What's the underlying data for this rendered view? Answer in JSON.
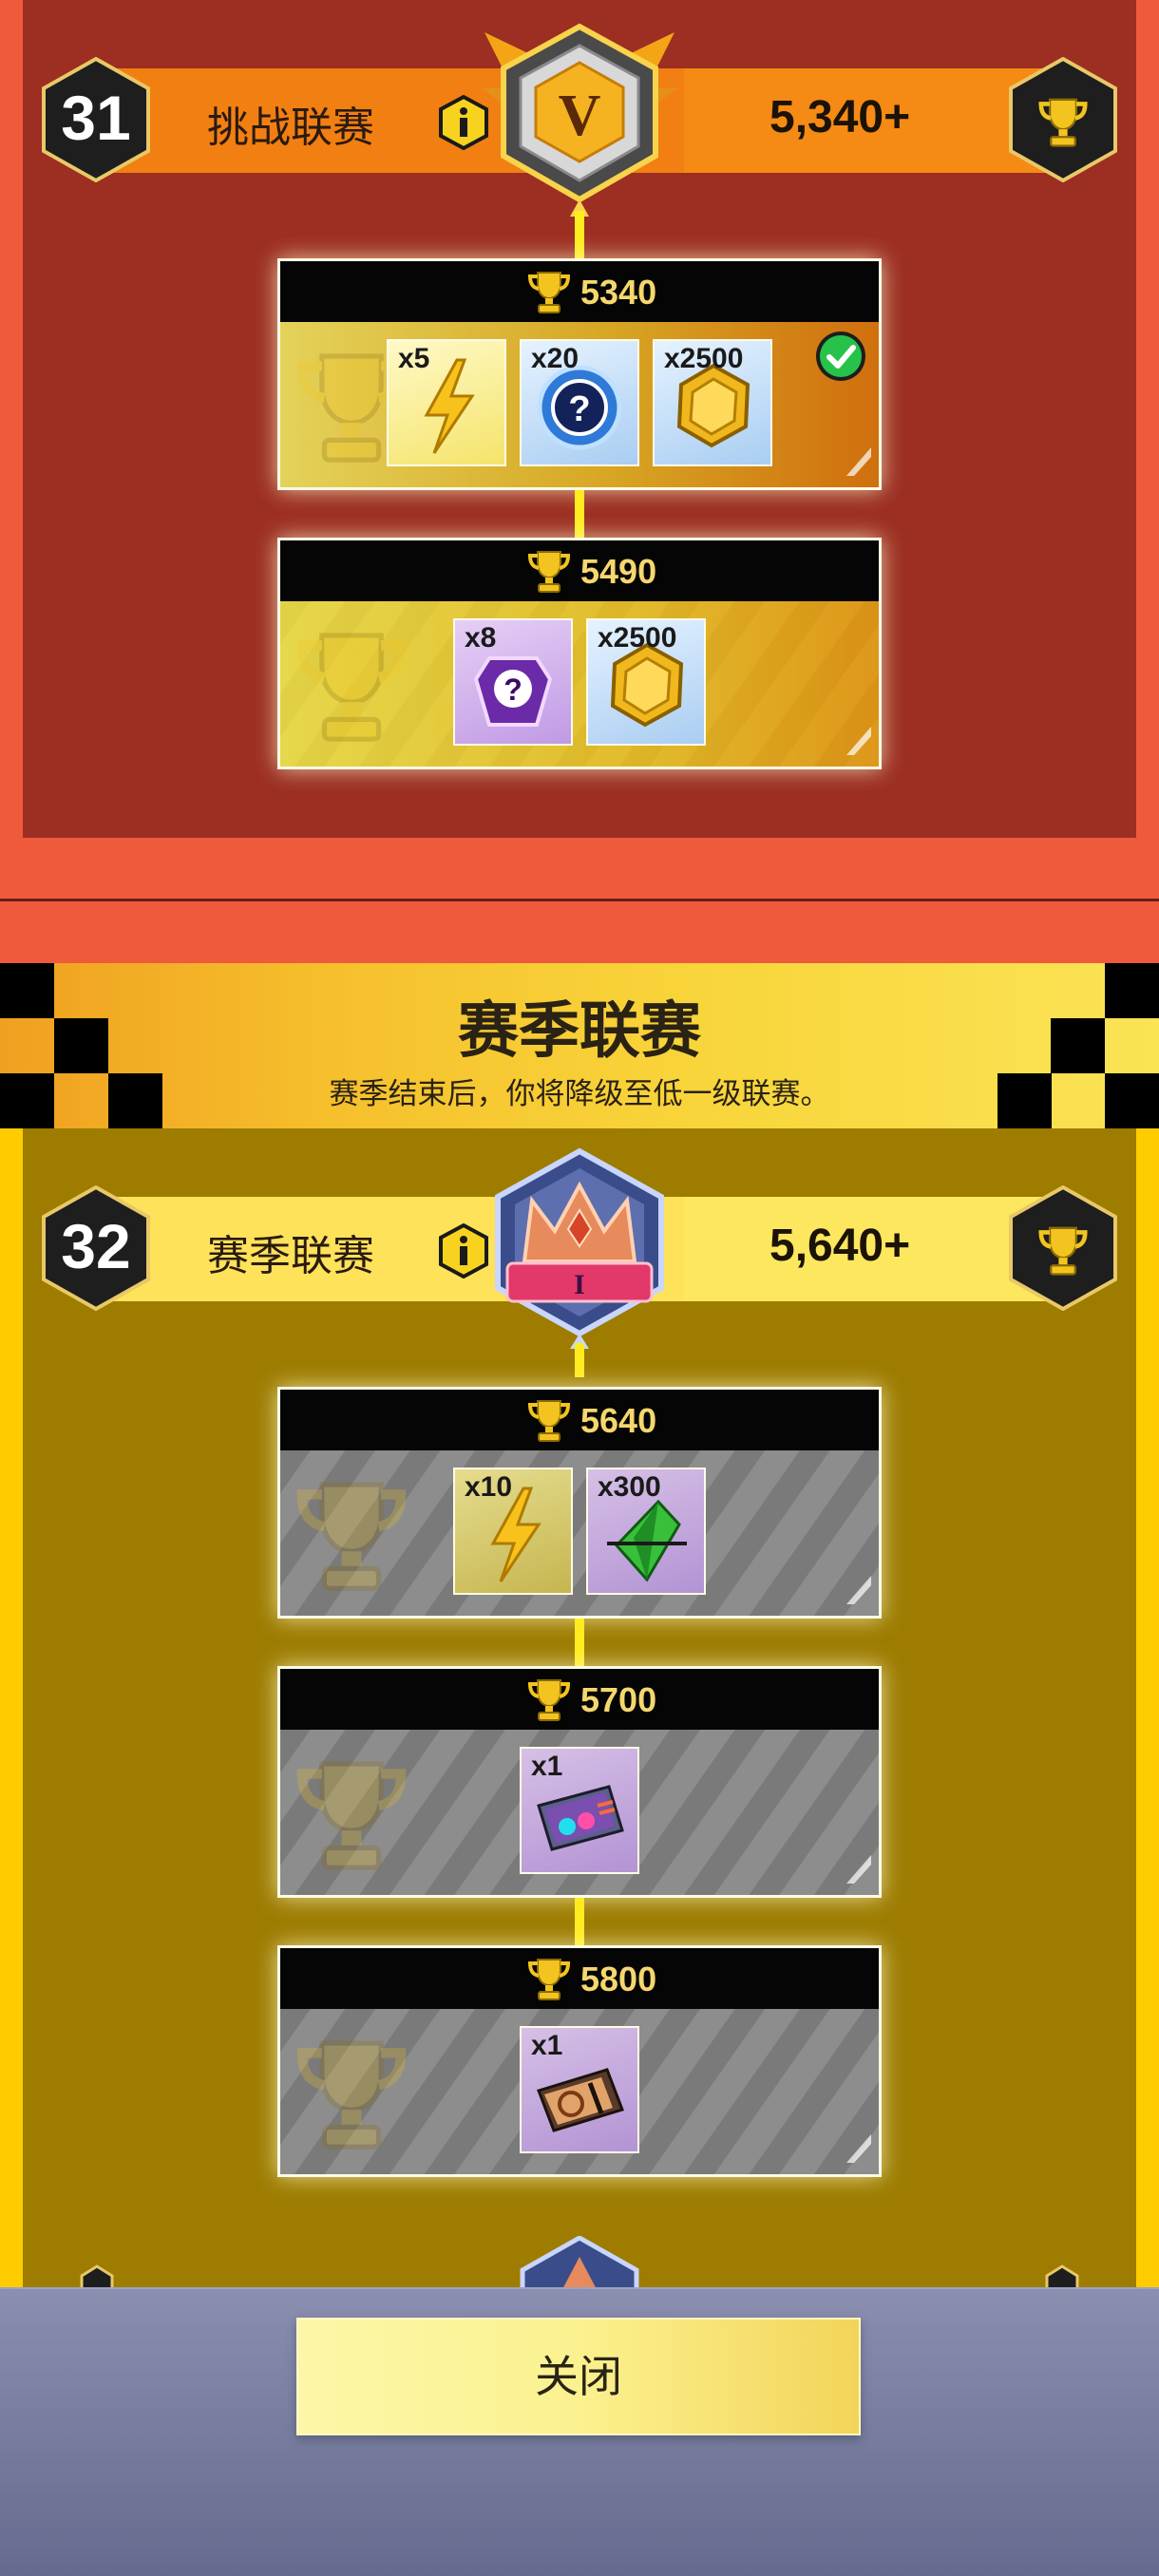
{
  "league_challenge": {
    "rank_number": "31",
    "name": "挑战联赛",
    "score_threshold": "5,340+",
    "emblem_letter": "V",
    "tiers": [
      {
        "trophies": "5340",
        "claimed": true,
        "rewards": [
          {
            "qty": "x5",
            "icon": "lightning-bolt-icon",
            "bg": "yellow"
          },
          {
            "qty": "x20",
            "icon": "mystery-token-icon",
            "bg": "blue"
          },
          {
            "qty": "x2500",
            "icon": "gold-hex-coin-icon",
            "bg": "blue"
          }
        ]
      },
      {
        "trophies": "5490",
        "claimed": false,
        "rewards": [
          {
            "qty": "x8",
            "icon": "purple-mystery-gem-icon",
            "bg": "purple"
          },
          {
            "qty": "x2500",
            "icon": "gold-hex-coin-icon",
            "bg": "blue"
          }
        ]
      }
    ]
  },
  "season_banner": {
    "title": "赛季联赛",
    "subtitle": "赛季结束后，你将降级至低一级联赛。"
  },
  "league_season": {
    "rank_number": "32",
    "name": "赛季联赛",
    "score_threshold": "5,640+",
    "emblem_letter": "I",
    "tiers": [
      {
        "trophies": "5640",
        "locked": true,
        "rewards": [
          {
            "qty": "x10",
            "icon": "lightning-bolt-icon",
            "bg": "gyellow"
          },
          {
            "qty": "x300",
            "icon": "green-crystal-icon",
            "bg": "gpurple"
          }
        ]
      },
      {
        "trophies": "5700",
        "locked": true,
        "rewards": [
          {
            "qty": "x1",
            "icon": "holographic-card-icon",
            "bg": "gpurple"
          }
        ]
      },
      {
        "trophies": "5800",
        "locked": true,
        "rewards": [
          {
            "qty": "x1",
            "icon": "ticket-card-icon",
            "bg": "gpurple"
          }
        ]
      }
    ]
  },
  "footer": {
    "close_label": "关闭"
  },
  "colors": {
    "challenge_bg": "#f05a3c",
    "challenge_panel": "#9c2e22",
    "season_bg": "#ffcc00",
    "season_panel": "#9d7c00",
    "connector": "#ffec1e",
    "trophy_gold": "#f5d76e"
  }
}
